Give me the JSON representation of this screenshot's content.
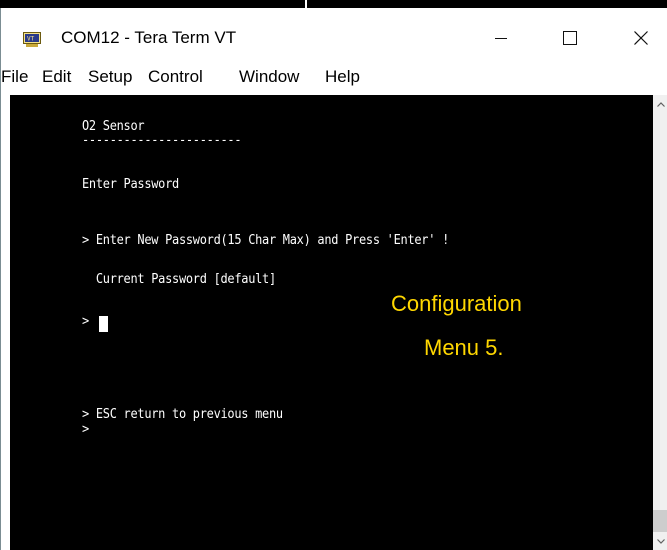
{
  "window": {
    "title": "COM12 - Tera Term VT",
    "icon": "tera-term-vt-icon",
    "controls": {
      "minimize": "minimize-icon",
      "maximize": "maximize-icon",
      "close": "close-icon"
    }
  },
  "menu": {
    "items": [
      "File",
      "Edit",
      "Setup",
      "Control",
      "Window",
      "Help"
    ]
  },
  "terminal": {
    "lines": [
      "O2 Sensor",
      "-----------------------",
      "Enter Password",
      "> Enter New Password(15 Char Max) and Press 'Enter' !",
      "  Current Password [default]",
      ">",
      "> ESC return to previous menu",
      ">"
    ],
    "overlay": [
      "Configuration",
      "Menu 5."
    ]
  },
  "colors": {
    "terminal_bg": "#000000",
    "terminal_text": "#ffffff",
    "overlay_text": "#ffd700"
  }
}
